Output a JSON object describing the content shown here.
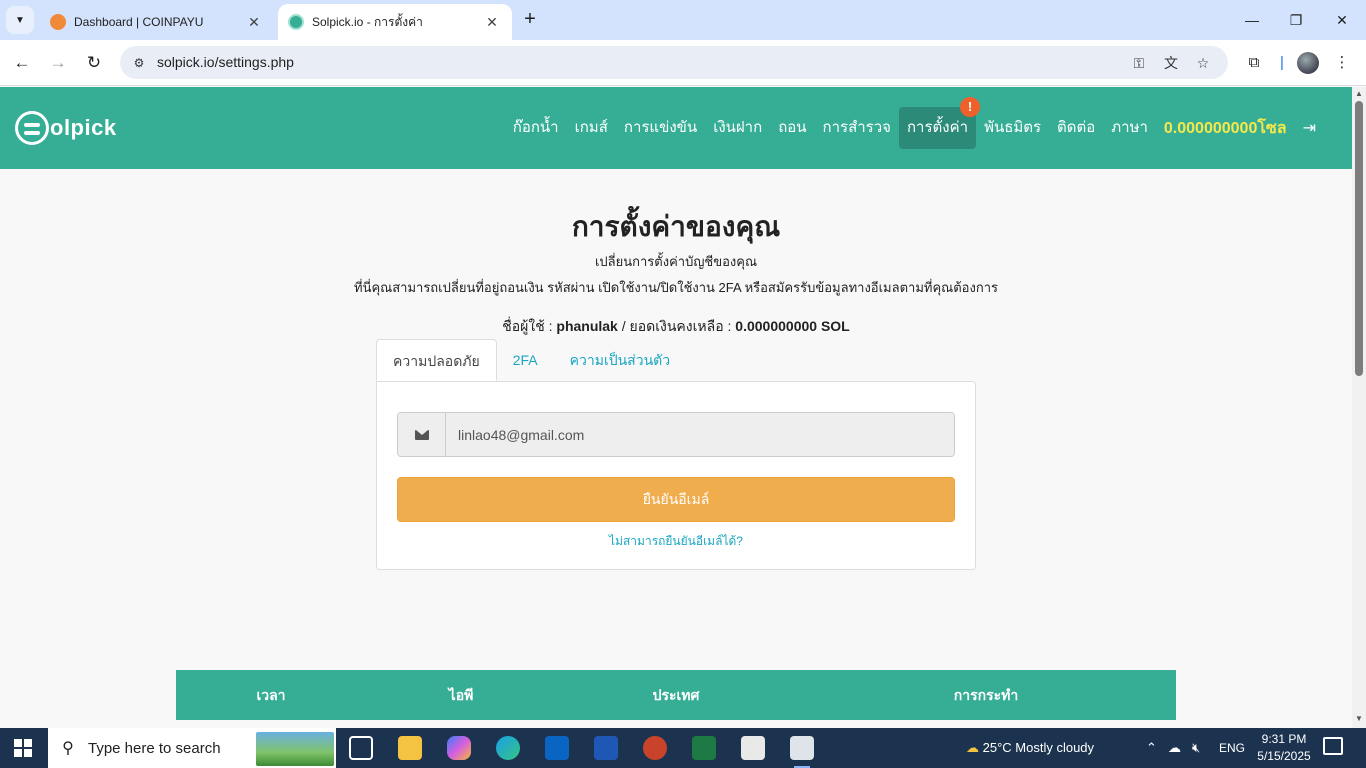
{
  "browser": {
    "tabs": [
      {
        "title": "Dashboard | COINPAYU",
        "favicon": "coinpayu-fox-icon",
        "active": false
      },
      {
        "title": "Solpick.io - การตั้งค่า",
        "favicon": "solpick-icon",
        "active": true
      }
    ],
    "url": "solpick.io/settings.php"
  },
  "header": {
    "logo_text": "olpick",
    "nav": [
      "ก๊อกน้ำ",
      "เกมส์",
      "การแข่งขัน",
      "เงินฝาก",
      "ถอน",
      "การสำรวจ",
      "การตั้งค่า",
      "พันธมิตร",
      "ติดต่อ",
      "ภาษา"
    ],
    "active_nav_index": 6,
    "settings_badge": "!",
    "balance": "0.000000000โซล",
    "colors": {
      "primary": "#36ae96",
      "balance": "#f7e84a",
      "badge": "#f0602a"
    }
  },
  "settings": {
    "title": "การตั้งค่าของคุณ",
    "subtitle": "เปลี่ยนการตั้งค่าบัญชีของคุณ",
    "description": "ที่นี่คุณสามารถเปลี่ยนที่อยู่ถอนเงิน รหัสผ่าน เปิดใช้งาน/ปิดใช้งาน 2FA หรือสมัครรับข้อมูลทางอีเมลตามที่คุณต้องการ",
    "username_label": "ชื่อผู้ใช้ :",
    "username": "phanulak",
    "balance_label": "/ ยอดเงินคงเหลือ :",
    "balance_value": "0.000000000 SOL",
    "tabs": [
      "ความปลอดภัย",
      "2FA",
      "ความเป็นส่วนตัว"
    ],
    "email_value": "linlao48@gmail.com",
    "confirm_button": "ยืนยันอีเมล์",
    "cant_confirm_link": "ไม่สามารถยืนยันอีเมล์ได้?",
    "button_color": "#f0ad4e"
  },
  "history_table": {
    "headers": [
      "เวลา",
      "ไอพี",
      "ประเทศ",
      "การกระทำ"
    ]
  },
  "taskbar": {
    "search_placeholder": "Type here to search",
    "weather": "25°C  Mostly cloudy",
    "language": "ENG",
    "time": "9:31 PM",
    "date": "5/15/2025"
  }
}
